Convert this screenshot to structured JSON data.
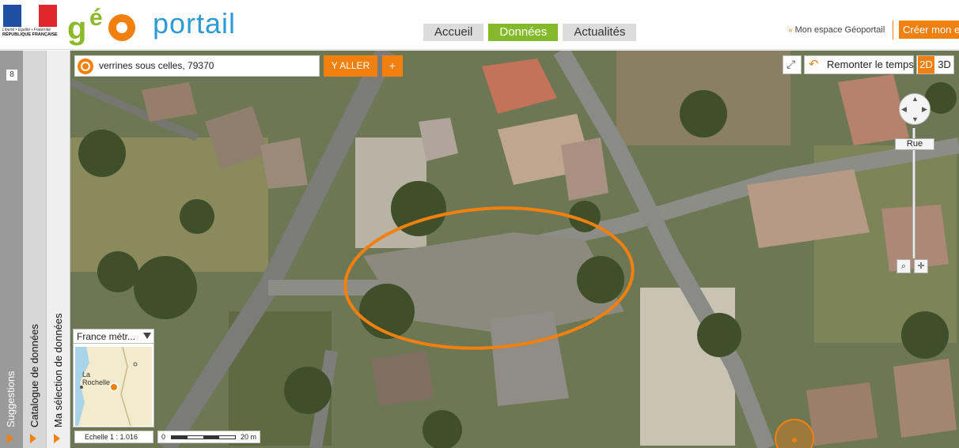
{
  "header": {
    "rf_motto": "Liberté • Égalité • Fraternité",
    "rf_name": "RÉPUBLIQUE FRANÇAISE",
    "brand_word": "portail",
    "nav_tabs": [
      {
        "label": "Accueil"
      },
      {
        "label": "Données",
        "active": true
      },
      {
        "label": "Actualités"
      }
    ],
    "espace_label": "Mon espace Géoportail",
    "creer_label": "Créer mon e"
  },
  "sidebar": {
    "suggestions": {
      "label": "Suggestions",
      "count": "8"
    },
    "catalogue": {
      "label": "Catalogue de données"
    },
    "selection": {
      "label": "Ma sélection de données"
    }
  },
  "map": {
    "search": {
      "value": "verrines sous celles, 79370"
    },
    "go_label": "Y ALLER",
    "plus_label": "+",
    "time_label": "Remonter le temps",
    "mode_2d": "2D",
    "mode_3d": "3D",
    "zoom_label": "Rue",
    "overview": {
      "select_label": "France métr...",
      "city_label": "La\nRochelle"
    },
    "scale_label": "Echelle 1 :  1.016",
    "scalebar": {
      "start": "0",
      "length": "20 m"
    }
  },
  "colors": {
    "accent": "#f2800f",
    "brand_green": "#84b92c",
    "brand_blue": "#2e9bd4",
    "highlight_ring": "#f2800f"
  }
}
